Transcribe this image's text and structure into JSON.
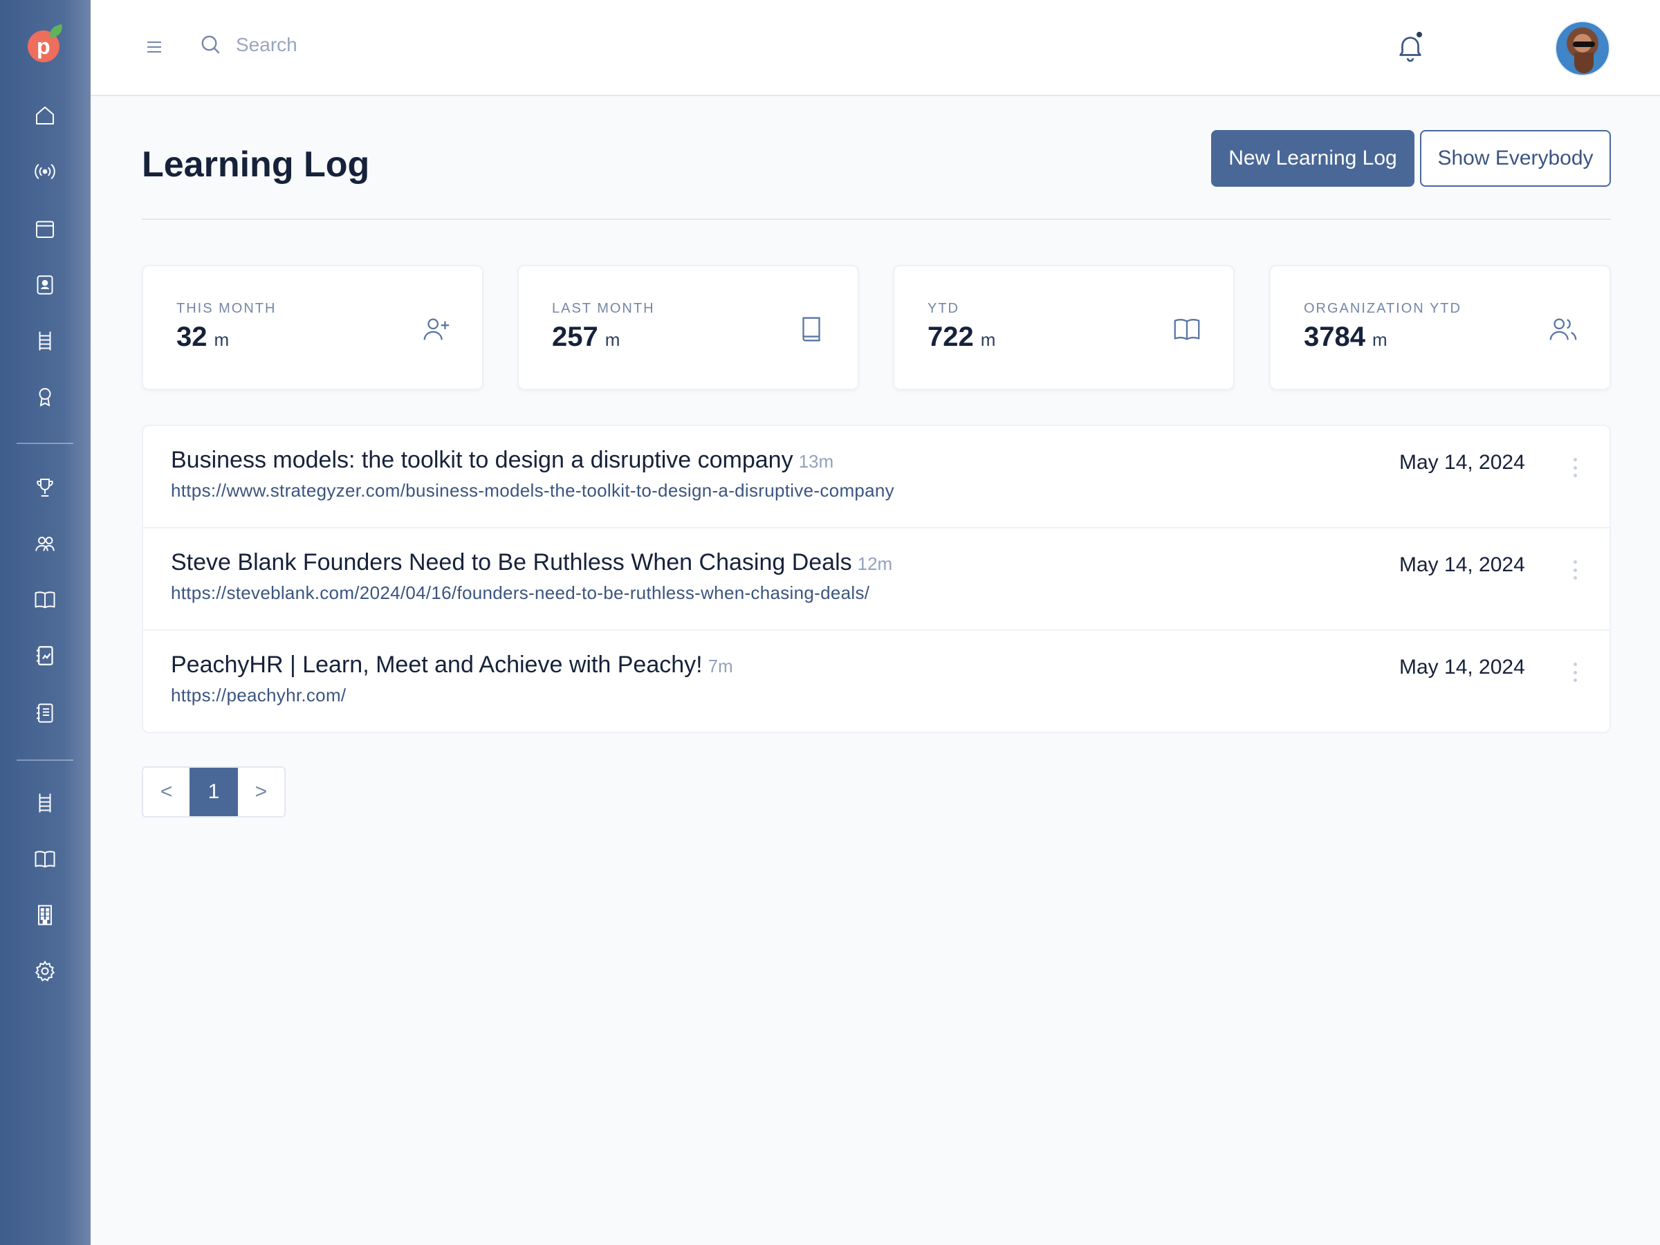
{
  "search": {
    "placeholder": "Search"
  },
  "page": {
    "title": "Learning Log"
  },
  "actions": {
    "new_label": "New Learning Log",
    "show_all_label": "Show Everybody"
  },
  "stats": [
    {
      "label": "THIS MONTH",
      "value": "32",
      "unit": "m",
      "icon": "user-plus-icon"
    },
    {
      "label": "LAST MONTH",
      "value": "257",
      "unit": "m",
      "icon": "book-icon"
    },
    {
      "label": "YTD",
      "value": "722",
      "unit": "m",
      "icon": "open-book-icon"
    },
    {
      "label": "ORGANIZATION YTD",
      "value": "3784",
      "unit": "m",
      "icon": "users-icon"
    }
  ],
  "logs": [
    {
      "title": "Business models: the toolkit to design a disruptive company",
      "duration": "13m",
      "url": "https://www.strategyzer.com/business-models-the-toolkit-to-design-a-disruptive-company",
      "date": "May 14, 2024"
    },
    {
      "title": "Steve Blank Founders Need to Be Ruthless When Chasing Deals",
      "duration": "12m",
      "url": "https://steveblank.com/2024/04/16/founders-need-to-be-ruthless-when-chasing-deals/",
      "date": "May 14, 2024"
    },
    {
      "title": "PeachyHR | Learn, Meet and Achieve with Peachy!",
      "duration": "7m",
      "url": "https://peachyhr.com/",
      "date": "May 14, 2024"
    }
  ],
  "pagination": {
    "prev": "<",
    "current": "1",
    "next": ">"
  },
  "colors": {
    "sidebar": "#4a6897",
    "accent": "#4a6897",
    "logo": "#ee6e5d"
  }
}
